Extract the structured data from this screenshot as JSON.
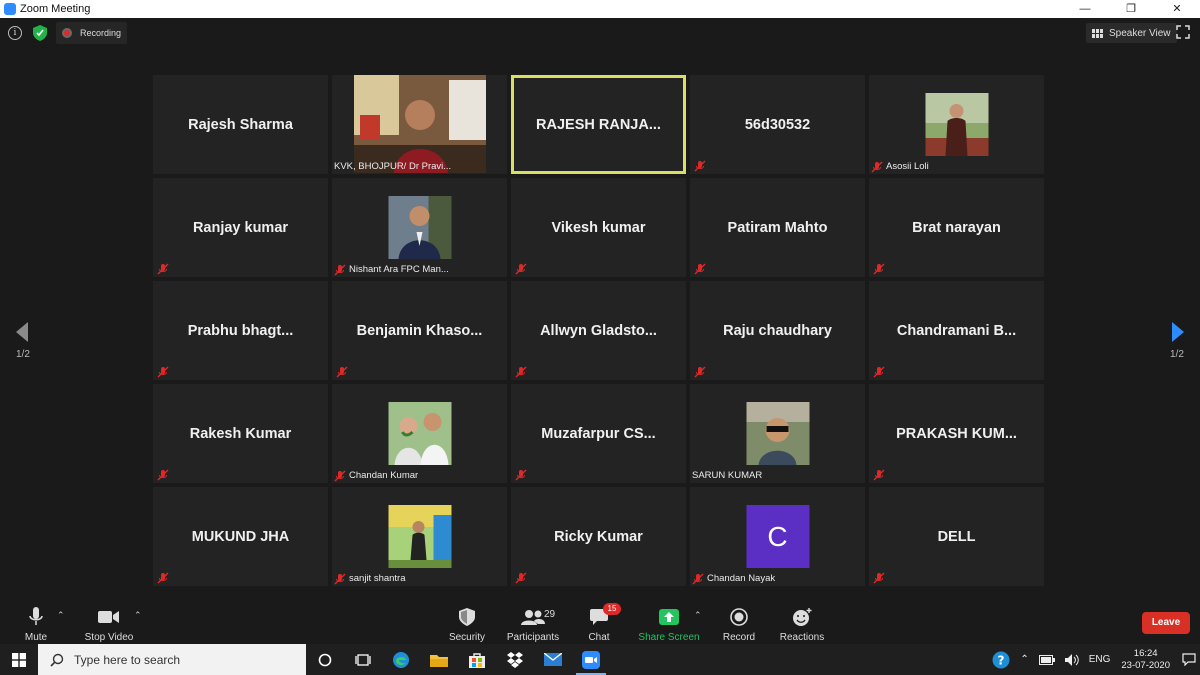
{
  "window": {
    "title": "Zoom Meeting",
    "controls": [
      "minimize",
      "maximize",
      "close"
    ]
  },
  "topbar": {
    "recording_label": "Recording",
    "view_label": "Speaker View"
  },
  "pager": {
    "left": "1/2",
    "right": "1/2"
  },
  "tiles": [
    {
      "name": "Rajesh Sharma",
      "label": "",
      "type": "name",
      "muted": false
    },
    {
      "name": "",
      "label": "KVK, BHOJPUR/ Dr Pravi...",
      "type": "video",
      "muted": false
    },
    {
      "name": "RAJESH  RANJA...",
      "label": "",
      "type": "name",
      "muted": false,
      "active": true
    },
    {
      "name": "56d30532",
      "label": "",
      "type": "name",
      "muted": true
    },
    {
      "name": "",
      "label": "Asosii Loli",
      "type": "photo",
      "muted": true
    },
    {
      "name": "Ranjay kumar",
      "label": "",
      "type": "name",
      "muted": true
    },
    {
      "name": "",
      "label": "Nishant Ara FPC Man...",
      "type": "photo",
      "muted": true
    },
    {
      "name": "Vikesh kumar",
      "label": "",
      "type": "name",
      "muted": true
    },
    {
      "name": "Patiram Mahto",
      "label": "",
      "type": "name",
      "muted": true
    },
    {
      "name": "Brat narayan",
      "label": "",
      "type": "name",
      "muted": true
    },
    {
      "name": "Prabhu  bhagt...",
      "label": "",
      "type": "name",
      "muted": true
    },
    {
      "name": "Benjamin  Khaso...",
      "label": "",
      "type": "name",
      "muted": true
    },
    {
      "name": "Allwyn  Gladsto...",
      "label": "",
      "type": "name",
      "muted": true
    },
    {
      "name": "Raju chaudhary",
      "label": "",
      "type": "name",
      "muted": true
    },
    {
      "name": "Chandramani  B...",
      "label": "",
      "type": "name",
      "muted": true
    },
    {
      "name": "Rakesh Kumar",
      "label": "",
      "type": "name",
      "muted": true
    },
    {
      "name": "",
      "label": "Chandan Kumar",
      "type": "photo",
      "muted": true
    },
    {
      "name": "Muzafarpur  CS...",
      "label": "",
      "type": "name",
      "muted": true
    },
    {
      "name": "",
      "label": "SARUN KUMAR",
      "type": "photo",
      "muted": false
    },
    {
      "name": "PRAKASH  KUM...",
      "label": "",
      "type": "name",
      "muted": true
    },
    {
      "name": "MUKUND JHA",
      "label": "",
      "type": "name",
      "muted": true
    },
    {
      "name": "",
      "label": "sanjit shantra",
      "type": "photo",
      "muted": true
    },
    {
      "name": "Ricky Kumar",
      "label": "",
      "type": "name",
      "muted": true
    },
    {
      "name": "",
      "label": "Chandan Nayak",
      "type": "avatar",
      "avatar_letter": "C",
      "muted": true
    },
    {
      "name": "DELL",
      "label": "",
      "type": "name",
      "muted": true
    }
  ],
  "toolbar": {
    "mute": "Mute",
    "stop_video": "Stop Video",
    "security": "Security",
    "participants": "Participants",
    "participants_count": "29",
    "chat": "Chat",
    "chat_badge": "15",
    "share_screen": "Share Screen",
    "record": "Record",
    "reactions": "Reactions",
    "leave": "Leave"
  },
  "taskbar": {
    "search_placeholder": "Type here to search",
    "lang": "ENG",
    "time": "16:24",
    "date": "23-07-2020"
  },
  "colors": {
    "active_speaker_border": "#d8df64",
    "leave_red": "#d93025",
    "share_green": "#22c55e",
    "avatar_purple": "#5b2fc4",
    "nav_blue": "#2d8cff"
  }
}
